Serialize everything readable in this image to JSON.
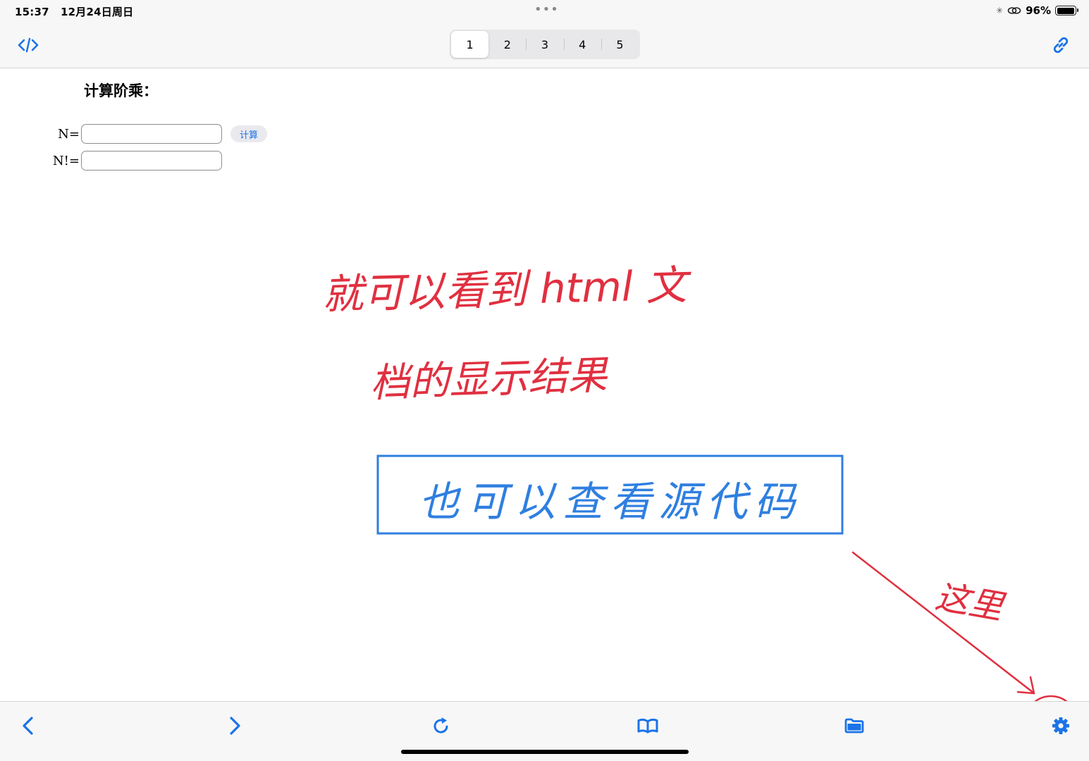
{
  "status_bar": {
    "time": "15:37",
    "date": "12月24日周日",
    "dots": "•••",
    "battery_percent": "96%",
    "battery_level": 0.96
  },
  "toolbar": {
    "code_icon": "code-brackets-icon",
    "link_icon": "link-icon",
    "tabs": [
      {
        "label": "1",
        "active": true
      },
      {
        "label": "2",
        "active": false
      },
      {
        "label": "3",
        "active": false
      },
      {
        "label": "4",
        "active": false
      },
      {
        "label": "5",
        "active": false
      }
    ]
  },
  "page": {
    "title": "计算阶乘：",
    "n_label": "N=",
    "n_value": "",
    "calc_button": "计算",
    "result_label": "N!=",
    "result_value": ""
  },
  "annotations": {
    "red_line_1": "就可以看到 html 文",
    "red_line_2": "档的显示结果",
    "blue_box_text": "也可以查看源代码",
    "pointer_text": "这里",
    "red_color": "#e03040",
    "blue_color": "#2f7fe0"
  },
  "bottom_toolbar": {
    "icons": [
      "back-chevron-icon",
      "forward-chevron-icon",
      "reload-icon",
      "book-icon",
      "folder-icon",
      "gear-icon"
    ],
    "accent": "#1a73e8"
  }
}
